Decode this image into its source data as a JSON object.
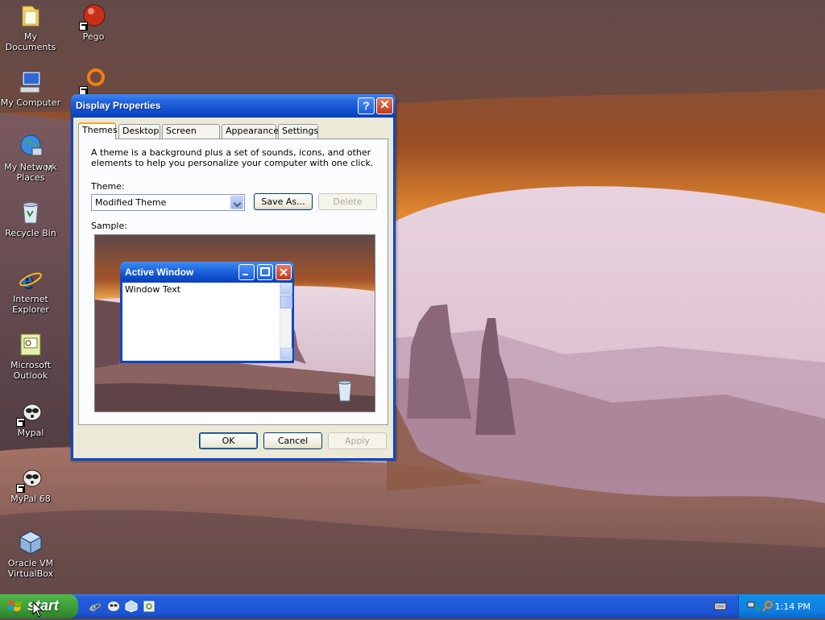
{
  "desktop": {
    "icons": [
      {
        "label": "My Documents"
      },
      {
        "label": "Pego"
      },
      {
        "label": "My Computer"
      },
      {
        "label": "My Network Places"
      },
      {
        "label": "Recycle Bin"
      },
      {
        "label": "Internet Explorer"
      },
      {
        "label": "Microsoft Outlook"
      },
      {
        "label": "Mypal"
      },
      {
        "label": "MyPal 68"
      },
      {
        "label": "Oracle VM VirtualBox"
      }
    ],
    "partial_label": "M"
  },
  "dialog": {
    "title": "Display Properties",
    "help_glyph": "?",
    "close_glyph": "✕",
    "tabs": [
      {
        "label": "Themes"
      },
      {
        "label": "Desktop"
      },
      {
        "label": "Screen Saver"
      },
      {
        "label": "Appearance"
      },
      {
        "label": "Settings"
      }
    ],
    "description": "A theme is a background plus a set of sounds, icons, and other elements to help you personalize your computer with one click.",
    "theme_label": "Theme:",
    "theme_value": "Modified Theme",
    "save_as_label": "Save As...",
    "delete_label": "Delete",
    "sample_label": "Sample:",
    "sample_window": {
      "title": "Active Window",
      "text": "Window Text"
    },
    "ok_label": "OK",
    "cancel_label": "Cancel",
    "apply_label": "Apply"
  },
  "taskbar": {
    "start_label": "start",
    "clock": "1:14 PM"
  },
  "colors": {
    "title_blue": "#0a48c8",
    "dialog_face": "#ece9d8",
    "start_green": "#3c9a37",
    "taskbar_blue": "#245edb"
  }
}
